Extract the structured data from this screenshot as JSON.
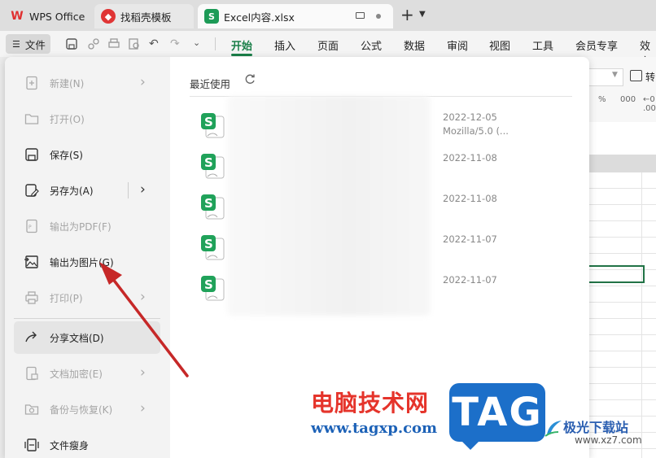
{
  "tabs": [
    {
      "label": "WPS Office",
      "icon": "wps-logo-icon"
    },
    {
      "label": "找稻壳模板",
      "icon": "daoke-logo-icon"
    },
    {
      "label": "Excel内容.xlsx",
      "icon": "excel-sheet-icon",
      "icon_text": "S",
      "active": true
    }
  ],
  "tab_extras": {
    "new_tab": "+",
    "chevron": "⌄"
  },
  "menubar": {
    "file_label": "文件",
    "tabs": [
      "开始",
      "插入",
      "页面",
      "公式",
      "数据",
      "审阅",
      "视图",
      "工具",
      "会员专享",
      "效率"
    ],
    "active_tab": "开始"
  },
  "toolbar_right": {
    "convert_label": "转",
    "formats": [
      "%",
      "000",
      "←0 .00"
    ]
  },
  "file_menu": {
    "items": [
      {
        "label": "新建(N)",
        "icon": "new-file-icon",
        "disabled": true,
        "chevron": true
      },
      {
        "label": "打开(O)",
        "icon": "open-folder-icon",
        "disabled": true,
        "chevron": false
      },
      {
        "label": "保存(S)",
        "icon": "save-icon",
        "disabled": false,
        "chevron": false
      },
      {
        "label": "另存为(A)",
        "icon": "save-as-icon",
        "disabled": false,
        "chevron": true
      },
      {
        "label": "输出为PDF(F)",
        "icon": "export-pdf-icon",
        "disabled": true,
        "chevron": false
      },
      {
        "label": "输出为图片(G)",
        "icon": "export-image-icon",
        "disabled": false,
        "chevron": false
      },
      {
        "label": "打印(P)",
        "icon": "print-icon",
        "disabled": true,
        "chevron": true
      },
      {
        "label": "分享文档(D)",
        "icon": "share-icon",
        "disabled": false,
        "chevron": false,
        "highlighted": true
      },
      {
        "label": "文档加密(E)",
        "icon": "encrypt-icon",
        "disabled": true,
        "chevron": true
      },
      {
        "label": "备份与恢复(K)",
        "icon": "backup-icon",
        "disabled": true,
        "chevron": true
      },
      {
        "label": "文件瘦身",
        "icon": "file-slim-icon",
        "disabled": false,
        "chevron": false
      }
    ]
  },
  "recent": {
    "title": "最近使用",
    "files": [
      {
        "date": "2022-12-05",
        "extra": "Mozilla/5.0 (..."
      },
      {
        "date": "2022-11-08"
      },
      {
        "date": "2022-11-08"
      },
      {
        "date": "2022-11-07"
      },
      {
        "date": "2022-11-07"
      }
    ]
  },
  "watermark": {
    "site_cn": "电脑技术网",
    "site_url": "www.tagxp.com",
    "tag": "TAG",
    "right_cn": "极光下载站",
    "right_url": "www.xz7.com"
  },
  "colors": {
    "accent": "#1a7f49",
    "excel_green": "#1d9b57",
    "annotation": "#cc2222"
  }
}
